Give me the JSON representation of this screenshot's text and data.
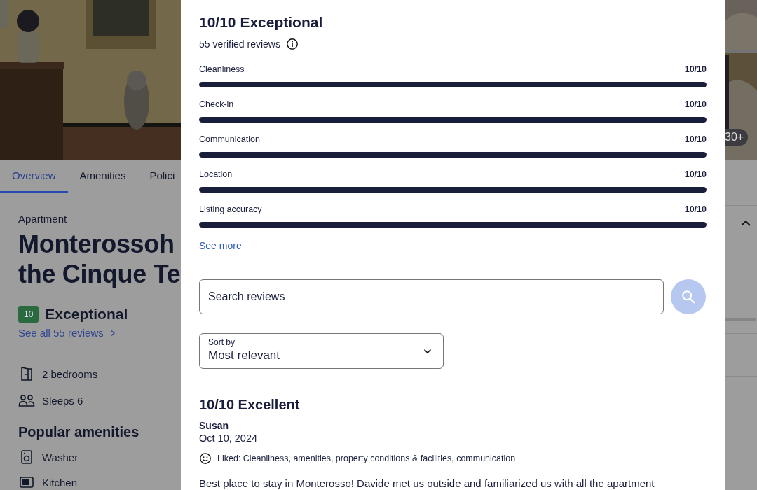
{
  "background_page": {
    "tabs": [
      {
        "label": "Overview",
        "selected": true
      },
      {
        "label": "Amenities",
        "selected": false
      },
      {
        "label": "Polici",
        "selected": false
      }
    ],
    "property_type": "Apartment",
    "title_lines": [
      "Monterossoh",
      "the Cinque Te"
    ],
    "score": {
      "badge": "10",
      "label": "Exceptional"
    },
    "reviews_link": "See all 55 reviews",
    "facts": [
      {
        "kind": "bedrooms",
        "text": "2 bedrooms"
      },
      {
        "kind": "sleeps",
        "text": "Sleeps 6"
      }
    ],
    "amenities_heading": "Popular amenities",
    "amenities": [
      {
        "kind": "washer",
        "text": "Washer"
      },
      {
        "kind": "kitchen",
        "text": "Kitchen"
      }
    ],
    "photo_count": "30+"
  },
  "reviews_dialog": {
    "title": "10/10 Exceptional",
    "subtitle": "55 verified reviews",
    "categories": [
      {
        "label": "Cleanliness",
        "score": "10/10",
        "level": 1
      },
      {
        "label": "Check-in",
        "score": "10/10",
        "level": 1
      },
      {
        "label": "Communication",
        "score": "10/10",
        "level": 1
      },
      {
        "label": "Location",
        "score": "10/10",
        "level": 1
      },
      {
        "label": "Listing accuracy",
        "score": "10/10",
        "level": 1
      }
    ],
    "see_more": "See more",
    "search": {
      "placeholder": "Search reviews"
    },
    "sort": {
      "label": "Sort by",
      "value": "Most relevant"
    },
    "reviews": [
      {
        "rating": "10/10 Excellent",
        "author": "Susan",
        "date": "Oct 10, 2024",
        "liked": "Liked: Cleanliness, amenities, property conditions & facilities, communication",
        "text": "Best place to stay in Monterosso! Davide met us outside and familiarized us with all the apartment"
      }
    ]
  }
}
